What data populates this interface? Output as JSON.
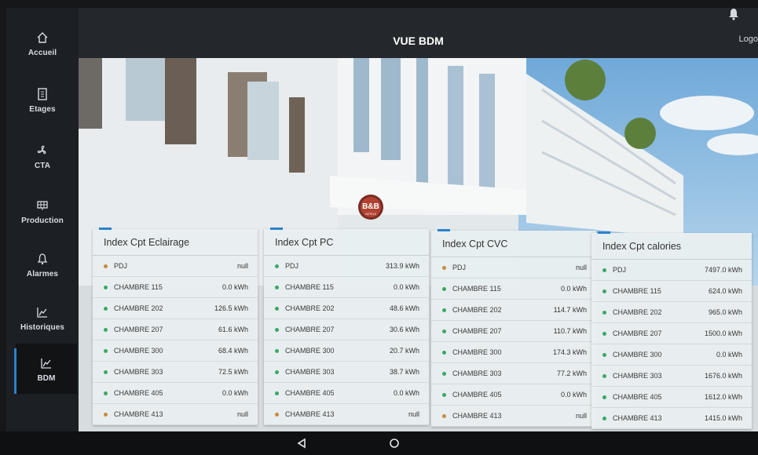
{
  "header": {
    "title": "VUE BDM",
    "logout_label": "Logo"
  },
  "sidebar": {
    "items": [
      {
        "label": "Accueil",
        "icon": "home-icon"
      },
      {
        "label": "Etages",
        "icon": "building-icon"
      },
      {
        "label": "CTA",
        "icon": "fan-icon"
      },
      {
        "label": "Production",
        "icon": "solar-panel-icon"
      },
      {
        "label": "Alarmes",
        "icon": "bell-icon"
      },
      {
        "label": "Historiques",
        "icon": "line-chart-icon"
      },
      {
        "label": "BDM",
        "icon": "line-chart-icon"
      }
    ]
  },
  "hero": {
    "logo_text": "B&B",
    "logo_subtext": "HOTELS"
  },
  "colors": {
    "accent": "#2b82c9",
    "dot_green": "#3aa866",
    "dot_orange": "#c98a3e"
  },
  "cards": [
    {
      "title": "Index Cpt Eclairage",
      "rows": [
        {
          "name": "PDJ",
          "value": "null",
          "status": "orange"
        },
        {
          "name": "CHAMBRE 115",
          "value": "0.0 kWh",
          "status": "green"
        },
        {
          "name": "CHAMBRE 202",
          "value": "126.5 kWh",
          "status": "green"
        },
        {
          "name": "CHAMBRE 207",
          "value": "61.6 kWh",
          "status": "green"
        },
        {
          "name": "CHAMBRE 300",
          "value": "68.4 kWh",
          "status": "green"
        },
        {
          "name": "CHAMBRE 303",
          "value": "72.5 kWh",
          "status": "green"
        },
        {
          "name": "CHAMBRE 405",
          "value": "0.0 kWh",
          "status": "green"
        },
        {
          "name": "CHAMBRE 413",
          "value": "null",
          "status": "orange"
        }
      ]
    },
    {
      "title": "Index Cpt PC",
      "rows": [
        {
          "name": "PDJ",
          "value": "313.9 kWh",
          "status": "green"
        },
        {
          "name": "CHAMBRE 115",
          "value": "0.0 kWh",
          "status": "green"
        },
        {
          "name": "CHAMBRE 202",
          "value": "48.6 kWh",
          "status": "green"
        },
        {
          "name": "CHAMBRE 207",
          "value": "30.6 kWh",
          "status": "green"
        },
        {
          "name": "CHAMBRE 300",
          "value": "20.7 kWh",
          "status": "green"
        },
        {
          "name": "CHAMBRE 303",
          "value": "38.7 kWh",
          "status": "green"
        },
        {
          "name": "CHAMBRE 405",
          "value": "0.0 kWh",
          "status": "green"
        },
        {
          "name": "CHAMBRE 413",
          "value": "null",
          "status": "orange"
        }
      ]
    },
    {
      "title": "Index Cpt CVC",
      "rows": [
        {
          "name": "PDJ",
          "value": "null",
          "status": "orange"
        },
        {
          "name": "CHAMBRE 115",
          "value": "0.0 kWh",
          "status": "green"
        },
        {
          "name": "CHAMBRE 202",
          "value": "114.7 kWh",
          "status": "green"
        },
        {
          "name": "CHAMBRE 207",
          "value": "110.7 kWh",
          "status": "green"
        },
        {
          "name": "CHAMBRE 300",
          "value": "174.3 kWh",
          "status": "green"
        },
        {
          "name": "CHAMBRE 303",
          "value": "77.2 kWh",
          "status": "green"
        },
        {
          "name": "CHAMBRE 405",
          "value": "0.0 kWh",
          "status": "green"
        },
        {
          "name": "CHAMBRE 413",
          "value": "null",
          "status": "orange"
        }
      ]
    },
    {
      "title": "Index Cpt calories",
      "rows": [
        {
          "name": "PDJ",
          "value": "7497.0 kWh",
          "status": "green"
        },
        {
          "name": "CHAMBRE 115",
          "value": "624.0 kWh",
          "status": "green"
        },
        {
          "name": "CHAMBRE 202",
          "value": "965.0 kWh",
          "status": "green"
        },
        {
          "name": "CHAMBRE 207",
          "value": "1500.0 kWh",
          "status": "green"
        },
        {
          "name": "CHAMBRE 300",
          "value": "0.0 kWh",
          "status": "green"
        },
        {
          "name": "CHAMBRE 303",
          "value": "1676.0 kWh",
          "status": "green"
        },
        {
          "name": "CHAMBRE 405",
          "value": "1612.0 kWh",
          "status": "green"
        },
        {
          "name": "CHAMBRE 413",
          "value": "1415.0 kWh",
          "status": "green"
        }
      ]
    }
  ]
}
